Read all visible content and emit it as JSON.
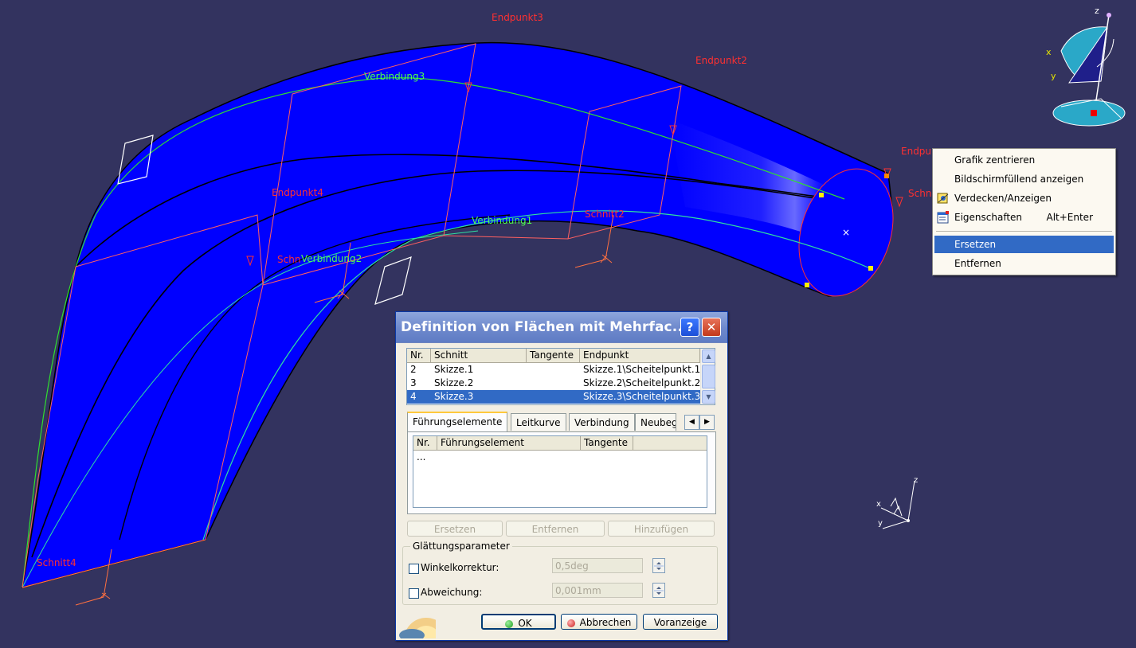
{
  "viewport": {
    "labels": {
      "endpunkt3": "Endpunkt3",
      "endpunkt2": "Endpunkt2",
      "endpunkt4": "Endpunkt4",
      "endpunkt1_partial": "Endpu",
      "verbindung3": "Verbindung3",
      "verbindung1": "Verbindung1",
      "verbindung2": "Verbindung2",
      "schnitt2_partial": "Schnitt2",
      "schnitt4": "Schnitt4",
      "schn_partial": "Schn",
      "schn_partial2": "Schn"
    },
    "compass": {
      "x": "x",
      "y": "y",
      "z": "z"
    },
    "axis_triad": {
      "z": "z",
      "x": "x",
      "y": "y"
    },
    "colors": {
      "background": "#33335f",
      "surface": "#0000ff",
      "annotation": "#ff3030",
      "guide": "#50ff50"
    }
  },
  "context_menu": {
    "items": [
      {
        "label": "Grafik zentrieren",
        "shortcut": ""
      },
      {
        "label": "Bildschirmfüllend anzeigen",
        "shortcut": ""
      },
      {
        "label": "Verdecken/Anzeigen",
        "shortcut": "",
        "icon": "hide-show-icon"
      },
      {
        "label": "Eigenschaften",
        "shortcut": "Alt+Enter",
        "icon": "properties-icon"
      },
      {
        "label": "Ersetzen",
        "shortcut": "",
        "selected": true
      },
      {
        "label": "Entfernen",
        "shortcut": ""
      }
    ]
  },
  "dialog": {
    "title": "Definition von Flächen mit Mehrfac...",
    "help": "?",
    "close": "✕",
    "sections_table": {
      "headers": [
        "Nr.",
        "Schnitt",
        "Tangente",
        "Endpunkt"
      ],
      "rows": [
        {
          "nr": "2",
          "schnitt": "Skizze.1",
          "tangente": "",
          "endpunkt": "Skizze.1\\Scheitelpunkt.1"
        },
        {
          "nr": "3",
          "schnitt": "Skizze.2",
          "tangente": "",
          "endpunkt": "Skizze.2\\Scheitelpunkt.2"
        },
        {
          "nr": "4",
          "schnitt": "Skizze.3",
          "tangente": "",
          "endpunkt": "Skizze.3\\Scheitelpunkt.3",
          "selected": true
        }
      ]
    },
    "tabs": [
      "Führungselemente",
      "Leitkurve",
      "Verbindung",
      "Neubeg"
    ],
    "guides_table": {
      "headers": [
        "Nr.",
        "Führungselement",
        "Tangente"
      ],
      "rows": [
        {
          "nr": "...",
          "element": "",
          "tangente": ""
        }
      ]
    },
    "buttons": {
      "replace": "Ersetzen",
      "remove": "Entfernen",
      "add": "Hinzufügen"
    },
    "smoothing": {
      "group_label": "Glättungsparameter",
      "angle_label": "Winkelkorrektur:",
      "angle_value": "0,5deg",
      "deviation_label": "Abweichung:",
      "deviation_value": "0,001mm"
    },
    "footer": {
      "ok": "OK",
      "cancel": "Abbrechen",
      "preview": "Voranzeige"
    }
  }
}
